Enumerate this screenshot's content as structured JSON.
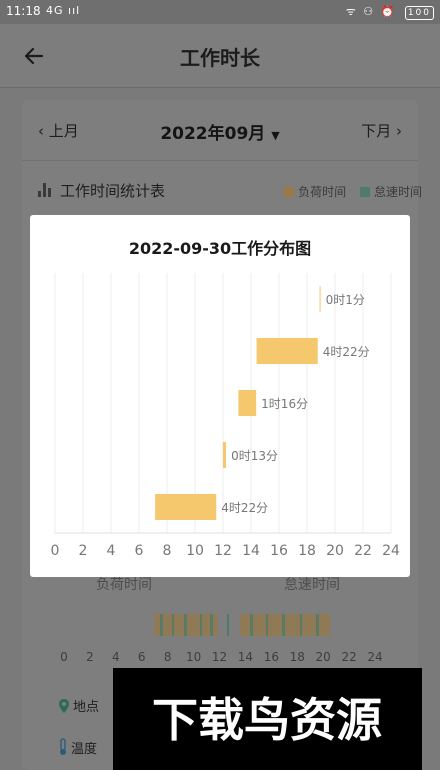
{
  "status_bar": {
    "time": "11:18",
    "signal": "4G ııl",
    "icons": "ᯤ ⚇ ⏰",
    "battery": "100"
  },
  "header": {
    "title": "工作时长"
  },
  "month_nav": {
    "prev": "上月",
    "current": "2022年09月",
    "next": "下月"
  },
  "section": {
    "title": "工作时间统计表"
  },
  "legend": {
    "items": [
      {
        "label": "负荷时间",
        "color": "#f6c86e"
      },
      {
        "label": "怠速时间",
        "color": "#6fcab0"
      }
    ]
  },
  "lower": {
    "load_label": "负荷时间",
    "idle_label": "怠速时间",
    "location_label": "地点",
    "temperature_label": "温度"
  },
  "lower_axis": [
    "0",
    "2",
    "4",
    "6",
    "8",
    "10",
    "12",
    "14",
    "16",
    "18",
    "20",
    "22",
    "24"
  ],
  "modal": {
    "title": "2022-09-30工作分布图"
  },
  "chart_data": {
    "type": "bar",
    "orientation": "horizontal-range",
    "title": "2022-09-30工作分布图",
    "xlim": [
      0,
      24
    ],
    "x_ticks": [
      "0",
      "2",
      "4",
      "6",
      "8",
      "10",
      "12",
      "14",
      "16",
      "18",
      "20",
      "22",
      "24"
    ],
    "bars": [
      {
        "start": 18.9,
        "end": 18.92,
        "label": "0时1分"
      },
      {
        "start": 14.4,
        "end": 18.77,
        "label": "4时22分"
      },
      {
        "start": 13.1,
        "end": 14.37,
        "label": "1时16分"
      },
      {
        "start": 12.0,
        "end": 12.22,
        "label": "0时13分"
      },
      {
        "start": 7.15,
        "end": 11.52,
        "label": "4时22分"
      }
    ],
    "bar_color": "#f6c86e",
    "grid": true
  }
}
